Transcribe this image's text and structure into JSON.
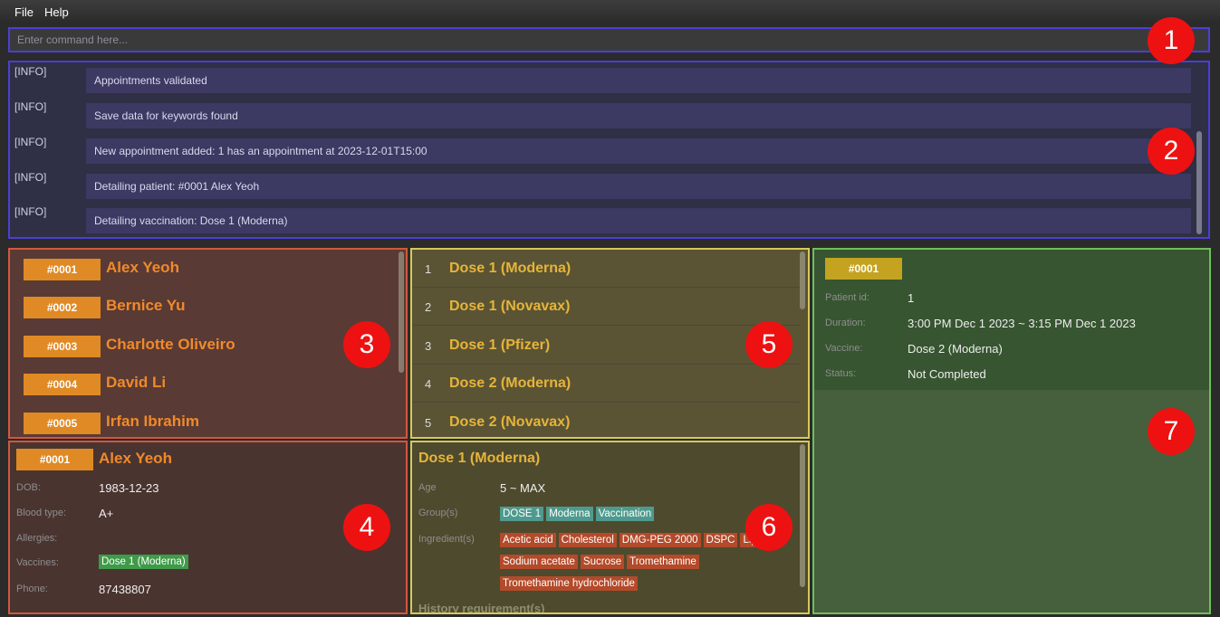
{
  "menu": {
    "file": "File",
    "help": "Help"
  },
  "command": {
    "placeholder": "Enter command here..."
  },
  "log": [
    {
      "level": "[INFO]",
      "message": "Appointments validated"
    },
    {
      "level": "[INFO]",
      "message": "Save data for keywords found"
    },
    {
      "level": "[INFO]",
      "message": "New appointment added: 1 has an appointment at 2023-12-01T15:00"
    },
    {
      "level": "[INFO]",
      "message": "Detailing patient: #0001 Alex Yeoh"
    },
    {
      "level": "[INFO]",
      "message": "Detailing vaccination: Dose 1 (Moderna)"
    }
  ],
  "patients": [
    {
      "id": "#0001",
      "name": "Alex Yeoh"
    },
    {
      "id": "#0002",
      "name": "Bernice Yu"
    },
    {
      "id": "#0003",
      "name": "Charlotte Oliveiro"
    },
    {
      "id": "#0004",
      "name": "David Li"
    },
    {
      "id": "#0005",
      "name": "Irfan Ibrahim"
    }
  ],
  "vaccinations": [
    {
      "index": "1",
      "name": "Dose 1 (Moderna)"
    },
    {
      "index": "2",
      "name": "Dose 1 (Novavax)"
    },
    {
      "index": "3",
      "name": "Dose 1 (Pfizer)"
    },
    {
      "index": "4",
      "name": "Dose 2 (Moderna)"
    },
    {
      "index": "5",
      "name": "Dose 2 (Novavax)"
    }
  ],
  "patient_detail": {
    "id": "#0001",
    "name": "Alex Yeoh",
    "dob_label": "DOB:",
    "dob": "1983-12-23",
    "blood_label": "Blood type:",
    "blood": "A+",
    "allergies_label": "Allergies:",
    "vaccines_label": "Vaccines:",
    "vaccines": [
      "Dose 1 (Moderna)"
    ],
    "phone_label": "Phone:",
    "phone": "87438807"
  },
  "vaccination_detail": {
    "title": "Dose 1 (Moderna)",
    "age_label": "Age",
    "age": "5 ~ MAX",
    "groups_label": "Group(s)",
    "groups": [
      "DOSE 1",
      "Moderna",
      "Vaccination"
    ],
    "ingredients_label": "Ingredient(s)",
    "ingredients": [
      "Acetic acid",
      "Cholesterol",
      "DMG-PEG 2000",
      "DSPC",
      "Lipid",
      "Sodium acetate",
      "Sucrose",
      "Tromethamine",
      "Tromethamine hydrochloride"
    ],
    "history_label": "History requirement(s)"
  },
  "appointment": {
    "id": "#0001",
    "patient_label": "Patient id:",
    "patient": "1",
    "duration_label": "Duration:",
    "duration": "3:00 PM Dec 1 2023 ~ 3:15 PM Dec 1 2023",
    "vaccine_label": "Vaccine:",
    "vaccine": "Dose 2 (Moderna)",
    "status_label": "Status:",
    "status": "Not Completed"
  },
  "annotations": [
    "1",
    "2",
    "3",
    "4",
    "5",
    "6",
    "7"
  ]
}
